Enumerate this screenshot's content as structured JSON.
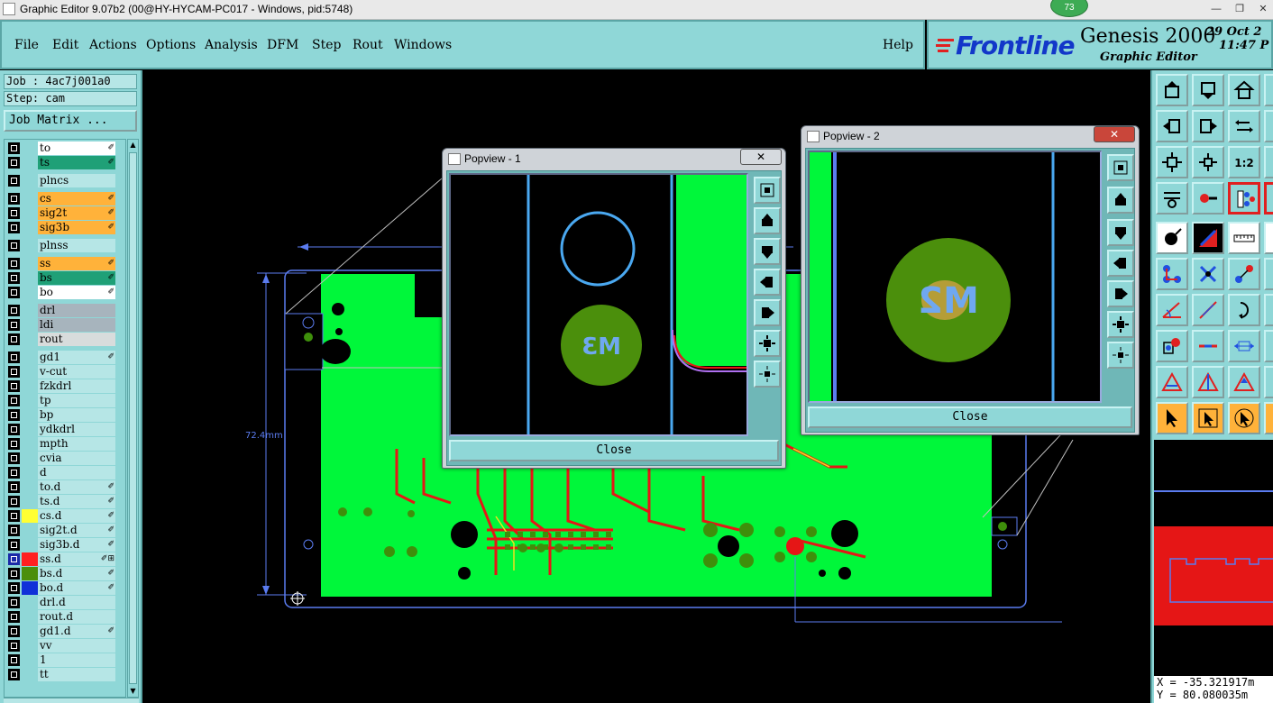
{
  "window": {
    "title": "Graphic Editor 9.07b2 (00@HY-HYCAM-PC017 - Windows, pid:5748)",
    "notification_count": "73"
  },
  "menu": {
    "items": [
      "File",
      "Edit",
      "Actions",
      "Options",
      "Analysis",
      "DFM",
      "Step",
      "Rout",
      "Windows"
    ],
    "help": "Help"
  },
  "brand": {
    "logo": "Frontline",
    "product": "Genesis 2000",
    "subtitle": "Graphic Editor",
    "date": "29 Oct 2",
    "time": "11:47 P"
  },
  "job": {
    "job_label": "Job : 4ac7j001a0",
    "step_label": "Step: cam",
    "matrix_button": "Job Matrix ..."
  },
  "layers": [
    {
      "name": "to",
      "color": "#ffffff",
      "mark": "✐"
    },
    {
      "name": "ts",
      "color": "#1fa077",
      "mark": "✐"
    },
    {
      "name": "plncs",
      "color": "#b6e6e6",
      "mark": ""
    },
    {
      "name": "cs",
      "color": "#ffb23a",
      "mark": "✐"
    },
    {
      "name": "sig2t",
      "color": "#ffb23a",
      "mark": "✐"
    },
    {
      "name": "sig3b",
      "color": "#ffb23a",
      "mark": "✐"
    },
    {
      "name": "plnss",
      "color": "#b6e6e6",
      "mark": ""
    },
    {
      "name": "ss",
      "color": "#ffb23a",
      "mark": "✐"
    },
    {
      "name": "bs",
      "color": "#1fa077",
      "mark": "✐"
    },
    {
      "name": "bo",
      "color": "#ffffff",
      "mark": "✐"
    },
    {
      "name": "drl",
      "color": "#a7b4bd",
      "mark": ""
    },
    {
      "name": "ldi",
      "color": "#a7b4bd",
      "mark": ""
    },
    {
      "name": "rout",
      "color": "#d8dcdc",
      "mark": ""
    },
    {
      "name": "gd1",
      "color": "#b6e6e6",
      "mark": "✐"
    },
    {
      "name": "v-cut",
      "color": "#b6e6e6",
      "mark": ""
    },
    {
      "name": "fzkdrl",
      "color": "#b6e6e6",
      "mark": ""
    },
    {
      "name": "tp",
      "color": "#b6e6e6",
      "mark": ""
    },
    {
      "name": "bp",
      "color": "#b6e6e6",
      "mark": ""
    },
    {
      "name": "ydkdrl",
      "color": "#b6e6e6",
      "mark": ""
    },
    {
      "name": "mpth",
      "color": "#b6e6e6",
      "mark": ""
    },
    {
      "name": "cvia",
      "color": "#b6e6e6",
      "mark": ""
    },
    {
      "name": "d",
      "color": "#b6e6e6",
      "mark": ""
    },
    {
      "name": "to.d",
      "color": "#b6e6e6",
      "mark": "✐"
    },
    {
      "name": "ts.d",
      "color": "#b6e6e6",
      "mark": "✐"
    },
    {
      "name": "cs.d",
      "color": "#b6e6e6",
      "mark": "✐",
      "swatch": "#ffff33"
    },
    {
      "name": "sig2t.d",
      "color": "#b6e6e6",
      "mark": "✐"
    },
    {
      "name": "sig3b.d",
      "color": "#b6e6e6",
      "mark": "✐"
    },
    {
      "name": "ss.d",
      "color": "#b6e6e6",
      "mark": "✐⊞",
      "swatch": "#ff2020",
      "checkcolor": "#1a2aa8"
    },
    {
      "name": "bs.d",
      "color": "#b6e6e6",
      "mark": "✐",
      "swatch": "#4b8f0c"
    },
    {
      "name": "bo.d",
      "color": "#b6e6e6",
      "mark": "✐",
      "swatch": "#1030d8"
    },
    {
      "name": "drl.d",
      "color": "#b6e6e6",
      "mark": ""
    },
    {
      "name": "rout.d",
      "color": "#b6e6e6",
      "mark": ""
    },
    {
      "name": "gd1.d",
      "color": "#b6e6e6",
      "mark": "✐"
    },
    {
      "name": "vv",
      "color": "#b6e6e6",
      "mark": ""
    },
    {
      "name": "1",
      "color": "#b6e6e6",
      "mark": ""
    },
    {
      "name": "tt",
      "color": "#b6e6e6",
      "mark": ""
    }
  ],
  "canvas": {
    "dimension_label": "72.4mm",
    "colors": {
      "board": "#00f73a",
      "copper": "#e51616",
      "outline": "#5b7cf0",
      "pad": "#3e8f0b"
    }
  },
  "popview1": {
    "title": "Popview - 1",
    "close_x": "✕",
    "pad_text": "M3",
    "close_button": "Close"
  },
  "popview2": {
    "title": "Popview - 2",
    "close_x": "✕",
    "pad_text": "M2",
    "close_button": "Close"
  },
  "coords": {
    "x": "X = -35.321917m",
    "y": "Y =  80.080035m"
  }
}
